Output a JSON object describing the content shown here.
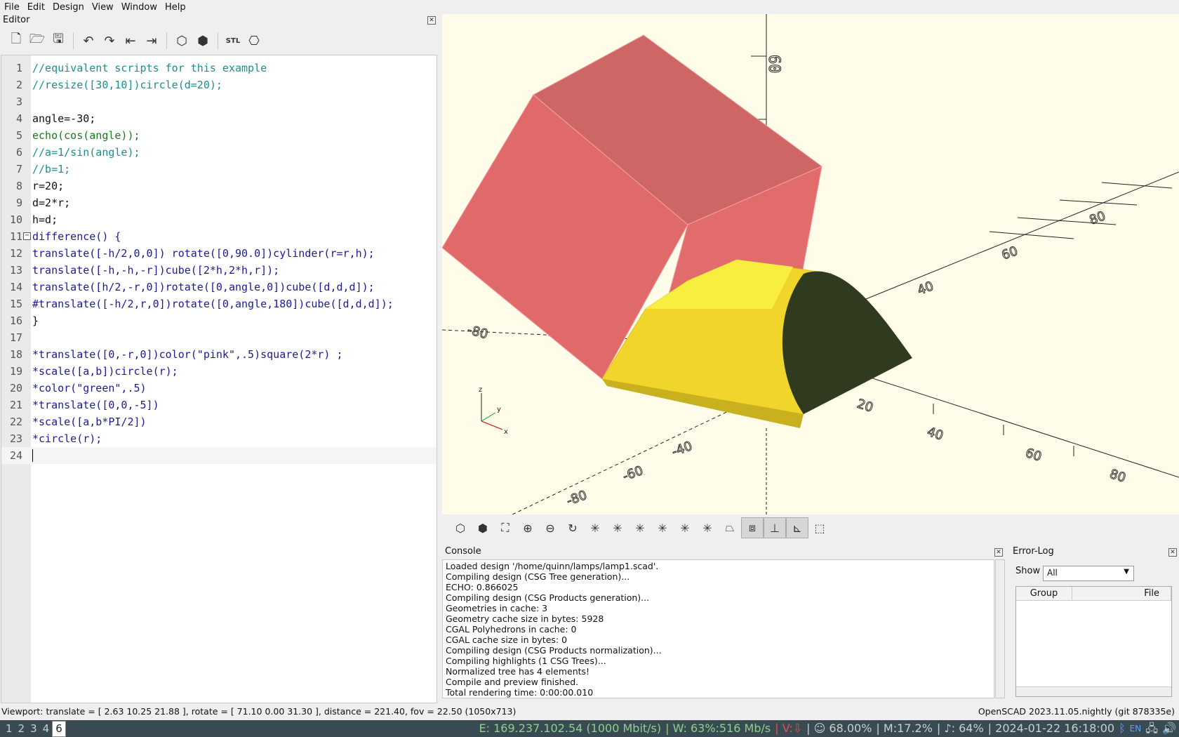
{
  "menu": [
    "File",
    "Edit",
    "Design",
    "View",
    "Window",
    "Help"
  ],
  "editor": {
    "title": "Editor",
    "lines": [
      {
        "n": "1",
        "t": "//equivalent scripts for this example"
      },
      {
        "n": "2",
        "t": "//resize([30,10])circle(d=20);"
      },
      {
        "n": "3",
        "t": ""
      },
      {
        "n": "4",
        "t": "angle=-30;"
      },
      {
        "n": "5",
        "t": "echo(cos(angle));"
      },
      {
        "n": "6",
        "t": "//a=1/sin(angle);"
      },
      {
        "n": "7",
        "t": "//b=1;"
      },
      {
        "n": "8",
        "t": "r=20;"
      },
      {
        "n": "9",
        "t": "d=2*r;"
      },
      {
        "n": "10",
        "t": "h=d;"
      },
      {
        "n": "11",
        "t": "difference() {"
      },
      {
        "n": "12",
        "t": "translate([-h/2,0,0]) rotate([0,90.0])cylinder(r=r,h);"
      },
      {
        "n": "13",
        "t": "translate([-h,-h,-r])cube([2*h,2*h,r]);"
      },
      {
        "n": "14",
        "t": "translate([h/2,-r,0])rotate([0,angle,0])cube([d,d,d]);"
      },
      {
        "n": "15",
        "t": "#translate([-h/2,r,0])rotate([0,angle,180])cube([d,d,d]);"
      },
      {
        "n": "16",
        "t": "}"
      },
      {
        "n": "17",
        "t": ""
      },
      {
        "n": "18",
        "t": "*translate([0,-r,0])color(\"pink\",.5)square(2*r) ;"
      },
      {
        "n": "19",
        "t": "*scale([a,b])circle(r);"
      },
      {
        "n": "20",
        "t": "*color(\"green\",.5)"
      },
      {
        "n": "21",
        "t": "*translate([0,0,-5])"
      },
      {
        "n": "22",
        "t": "*scale([a,b*PI/2])"
      },
      {
        "n": "23",
        "t": "*circle(r);"
      },
      {
        "n": "24",
        "t": ""
      }
    ]
  },
  "viewport": {
    "axis_labels_z": [
      "60",
      "40",
      "20"
    ],
    "axis_labels_x": [
      "-80",
      "-40",
      "20",
      "40",
      "60",
      "80"
    ],
    "axis_labels_y": [
      "-80",
      "-60",
      "-40",
      "80",
      "60",
      "40"
    ],
    "axes_indicator": {
      "x": "x",
      "y": "y",
      "z": "z"
    },
    "colors": {
      "background": "#fffdea",
      "highlight": "#e06a6a",
      "surface": "#f0d52a",
      "cut_face": "#2f3a1e"
    }
  },
  "console": {
    "title": "Console",
    "lines": [
      "Loaded design '/home/quinn/lamps/lamp1.scad'.",
      "Compiling design (CSG Tree generation)...",
      "ECHO: 0.866025",
      "Compiling design (CSG Products generation)...",
      "Geometries in cache: 3",
      "Geometry cache size in bytes: 5928",
      "CGAL Polyhedrons in cache: 0",
      "CGAL cache size in bytes: 0",
      "Compiling design (CSG Products normalization)...",
      "Compiling highlights (1 CSG Trees)...",
      "Normalized tree has 4 elements!",
      "Compile and preview finished.",
      "Total rendering time: 0:00:00.010"
    ]
  },
  "errorlog": {
    "title": "Error-Log",
    "show_label": "Show",
    "show_value": "All",
    "columns": [
      "Group",
      "File"
    ]
  },
  "status": {
    "left": "Viewport: translate = [ 2.63 10.25 21.88 ], rotate = [ 71.10 0.00 31.30 ], distance = 221.40, fov = 22.50 (1050x713)",
    "right": "OpenSCAD 2023.11.05.nightly (git 878335e)"
  },
  "taskbar": {
    "workspaces": [
      "1",
      "2",
      "3",
      "4",
      "6"
    ],
    "active_workspace": "6",
    "net_e": "E: 169.237.102.54 (1000 Mbit/s)",
    "net_w": "| W: 63%:516 Mb/s",
    "vpn": "| V:",
    "vpn_arrow": "⇩",
    "battery": "| ☺ 68.00%",
    "mem": "| M:17.2%",
    "vol": "| ♪: 64%",
    "datetime": "| 2024-01-22 16:18:00",
    "icons": [
      "bluetooth-icon",
      "keyboard-layout-icon",
      "network-icon",
      "volume-icon"
    ],
    "kbd": "EN"
  }
}
